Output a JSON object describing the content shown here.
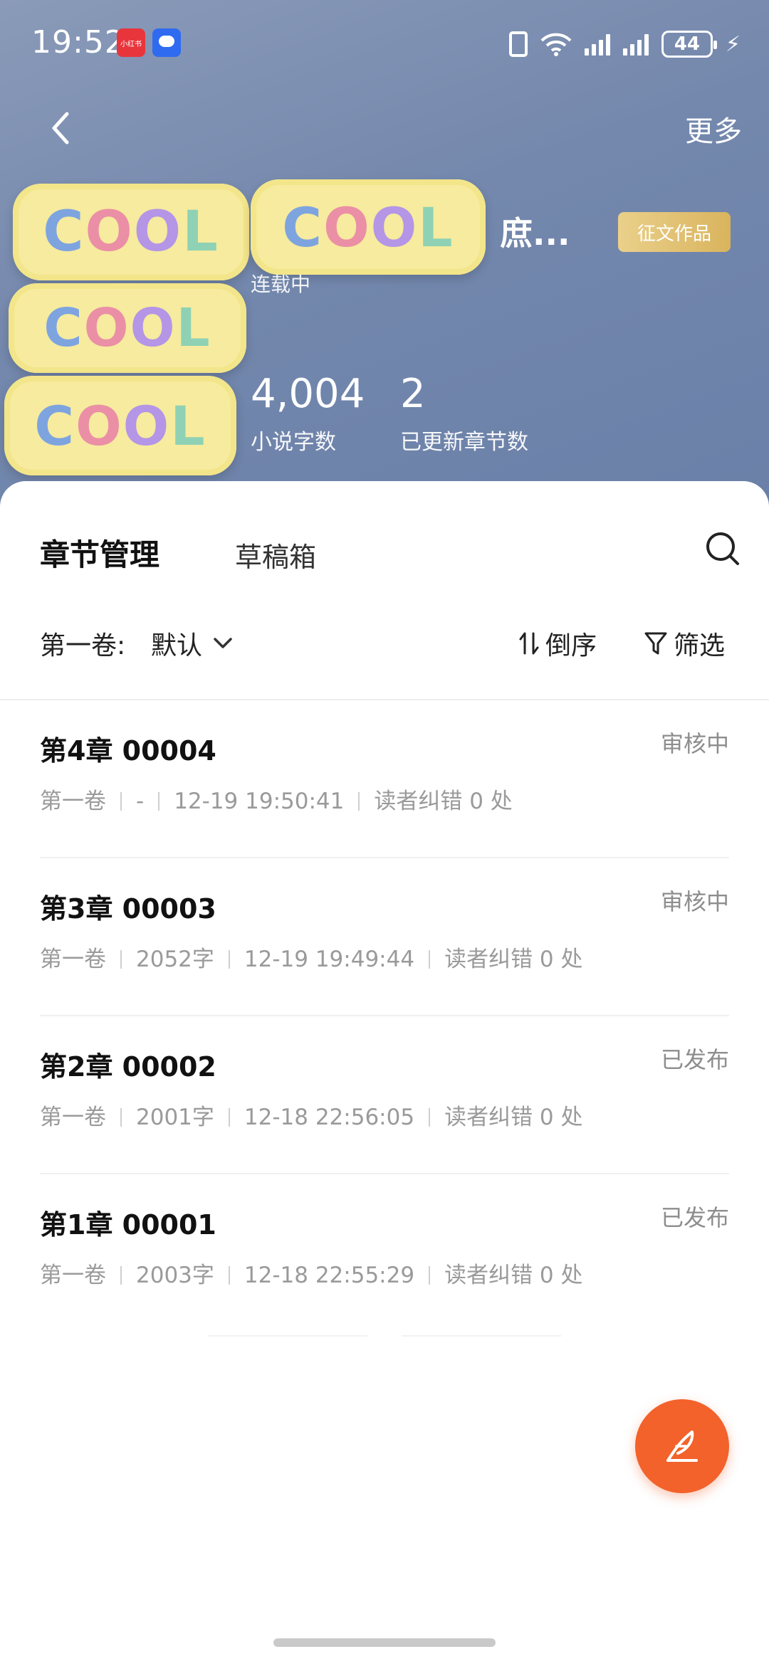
{
  "status_bar": {
    "time": "19:52",
    "app_badge_1": "小红书",
    "battery": "44"
  },
  "nav": {
    "more_label": "更多"
  },
  "book": {
    "cover_word": "COOL",
    "title": "庶...",
    "contest_badge": "征文作品",
    "serial_status": "连载中",
    "word_count": "4,004",
    "word_count_label": "小说字数",
    "chapter_count": "2",
    "chapter_count_label": "已更新章节数"
  },
  "tabs": {
    "active": "章节管理",
    "draft": "草稿箱"
  },
  "filterbar": {
    "volume_label": "第一卷:",
    "volume_value": "默认",
    "sort_label": "倒序",
    "filter_label": "筛选"
  },
  "chapters": [
    {
      "title": "第4章 00004",
      "status": "审核中",
      "volume": "第一卷",
      "words": "-",
      "time": "12-19 19:50:41",
      "errata": "读者纠错 0 处"
    },
    {
      "title": "第3章 00003",
      "status": "审核中",
      "volume": "第一卷",
      "words": "2052字",
      "time": "12-19 19:49:44",
      "errata": "读者纠错 0 处"
    },
    {
      "title": "第2章 00002",
      "status": "已发布",
      "volume": "第一卷",
      "words": "2001字",
      "time": "12-18 22:56:05",
      "errata": "读者纠错 0 处"
    },
    {
      "title": "第1章 00001",
      "status": "已发布",
      "volume": "第一卷",
      "words": "2003字",
      "time": "12-18 22:55:29",
      "errata": "读者纠错 0 处"
    }
  ],
  "colors": {
    "accent": "#f2622a",
    "hero_bg": "#7488ad",
    "badge_gold": "#d9b45e"
  },
  "icons": {
    "back": "chevron-left-icon",
    "search": "search-icon",
    "volume_dropdown": "chevron-down-icon",
    "sort": "sort-icon",
    "filter": "filter-icon",
    "fab": "quill-pen-icon"
  }
}
